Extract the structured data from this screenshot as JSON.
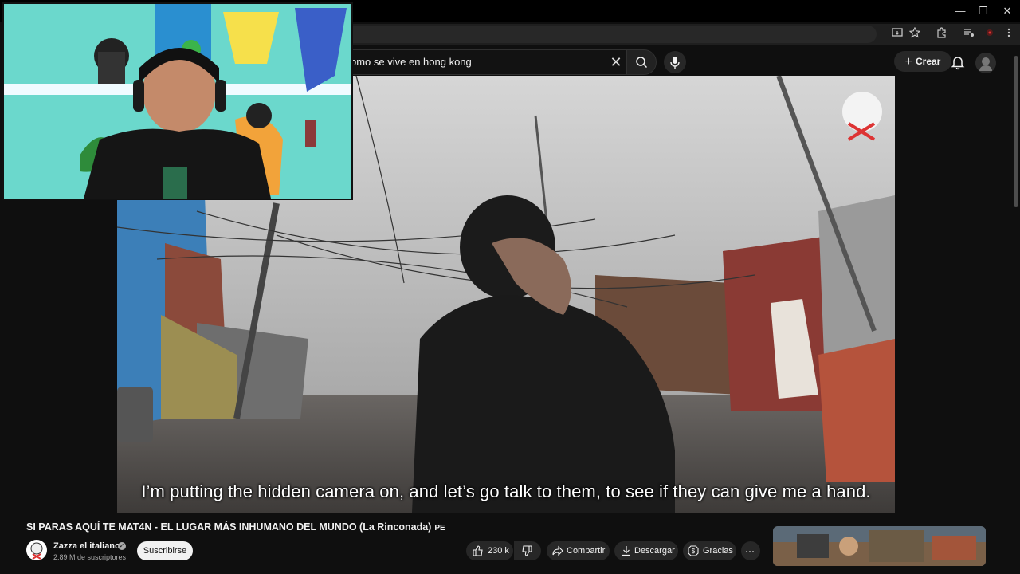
{
  "browser": {
    "window_controls": [
      "—",
      "❐",
      "✕"
    ],
    "address_icons": [
      "install-icon",
      "star-icon",
      "extensions-icon",
      "media-icon",
      "profile-icon",
      "menu-icon"
    ]
  },
  "youtube_header": {
    "search_value": "omo se vive en hong kong",
    "create_label": "Crear"
  },
  "video": {
    "subtitle": "I’m putting the hidden camera on, and let’s go talk to them, to see if they can give me a hand."
  },
  "info": {
    "title": "SI PARAS AQUÍ TE MAT4N - EL LUGAR MÁS INHUMANO DEL MUNDO (La Rinconada)",
    "country_badge": "PE",
    "channel_name": "Zazza el italiano",
    "subscribers": "2.89 M de suscriptores",
    "subscribe_label": "Suscribirse",
    "likes": "230 k",
    "share_label": "Compartir",
    "download_label": "Descargar",
    "thanks_label": "Gracias",
    "more_label": "···"
  },
  "colors": {
    "page_bg": "#0f0f0f",
    "pill_bg": "#272727",
    "subscribe_bg": "#f1f1f1",
    "webcam_bg": "#5fd4c9"
  }
}
